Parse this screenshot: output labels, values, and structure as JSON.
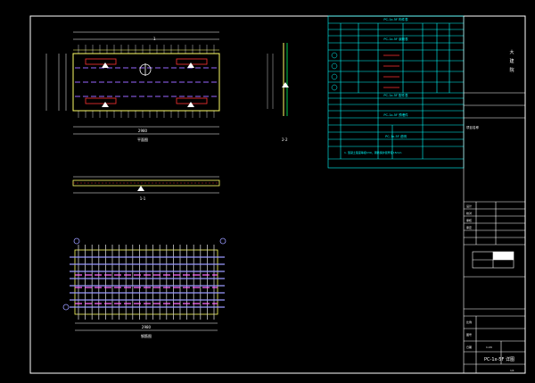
{
  "drawing": {
    "plan_label": "平面图",
    "section_label": "1-1",
    "side_label": "2-2",
    "rebar_label": "钢筋图",
    "overall_dim": "2980",
    "rebar_dim": "2980",
    "mark_1": "1",
    "mark_2": "2",
    "mark_a": "A"
  },
  "tables": {
    "t1_title": "PC-1x-5F 构件表",
    "t2_title": "PC-1x-5F 钢筋表",
    "t3_title": "PC-1x-5F 配件表",
    "t4_title": "PC-1x-5F 预埋件",
    "t5_title": "PC-1x-5F 说明",
    "t1_headers": [
      "编号",
      "规格",
      "长度",
      "宽度",
      "厚度",
      "重量",
      "数量"
    ],
    "t1_row": [
      "PC-1x-5F",
      "1",
      "2980",
      "1200",
      "60",
      "0.54",
      "1"
    ],
    "t2_rows": [
      {
        "no": "①",
        "spec": "C8",
        "len": "2980",
        "n": "12"
      },
      {
        "no": "②",
        "spec": "C8",
        "len": "1180",
        "n": "30"
      },
      {
        "no": "③",
        "spec": "C6",
        "len": "2960",
        "n": "6"
      },
      {
        "no": "④",
        "spec": "C6",
        "len": "1160",
        "n": "16"
      }
    ],
    "notes_title": "说明",
    "note_text": "1. 混凝土强度等级C30，钢筋保护层厚度15mm"
  },
  "titleblock": {
    "company_line1": "大",
    "company_line2": "建",
    "company_line3": "院",
    "project_label": "项目名称",
    "designer": "设计",
    "checker": "校对",
    "reviewer": "审核",
    "approver": "审定",
    "drawing_name": "PC-1x-5F 详图",
    "scale_label": "比例",
    "scale_value": "1:20",
    "sheet_label": "图号",
    "date_label": "日期",
    "page": "1/1"
  }
}
